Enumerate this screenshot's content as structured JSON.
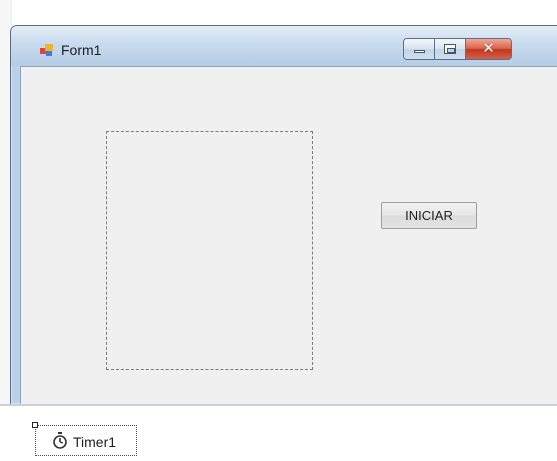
{
  "window": {
    "title": "Form1",
    "icon": "winforms-form-icon",
    "caption_buttons": [
      {
        "name": "minimize",
        "icon": "minimize-icon"
      },
      {
        "name": "maximize",
        "icon": "maximize-icon"
      },
      {
        "name": "close",
        "icon": "close-icon",
        "glyph": "✕"
      }
    ]
  },
  "form": {
    "picture_box": "",
    "iniciar_button_label": "INICIAR"
  },
  "component_tray": {
    "components": [
      {
        "label": "Timer1",
        "icon": "stopwatch-icon"
      }
    ]
  },
  "colors": {
    "form_background": "#f0f0f0",
    "title_bar": "#c8daee",
    "close_button": "#c1361d"
  }
}
